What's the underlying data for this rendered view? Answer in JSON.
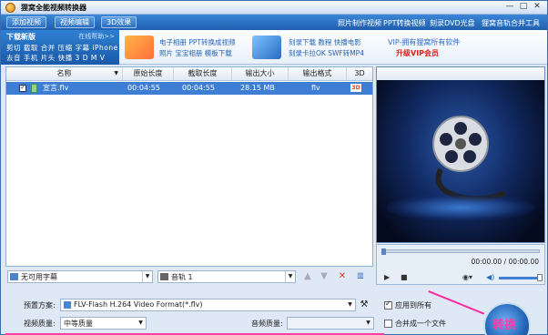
{
  "window": {
    "title": "狸窝全能视频转换器",
    "controls": [
      "—",
      "□",
      "✕"
    ]
  },
  "menubar": {
    "buttons": [
      "添加视频",
      "视频编辑",
      "3D效果"
    ],
    "links": [
      "照片制作视频",
      "PPT转换视频",
      "刻录DVD光盘",
      "狸窝音轨合并工具"
    ]
  },
  "banner": {
    "download": {
      "title": "下载新版",
      "more": "在线帮助>>",
      "row1": "剪切 截取 合并 压缩 字幕 iPhone",
      "row2": "去音 手机 片头 快播 3 D M V"
    },
    "promo1": {
      "line1": "电子相册 PPT转换成视频",
      "line2": "照片 宝宝相册 模板下载"
    },
    "promo2": {
      "line1": "刻录下载 教程 快播电影",
      "line2": "刻录卡拉OK SWF转MP4"
    },
    "vip": {
      "line1": "VIP-拥有狸窝所有软件",
      "line2": "升级VIP会员"
    }
  },
  "file_list": {
    "columns": [
      "名称",
      "原始长度",
      "截取长度",
      "输出大小",
      "输出格式",
      "3D"
    ],
    "rows": [
      {
        "name": "宣言.flv",
        "original": "00:04:55",
        "clip": "00:04:55",
        "size": "28.15 MB",
        "format": "flv",
        "checked": true
      }
    ]
  },
  "list_toolbar": {
    "subtitle": "无可用字幕",
    "audio_track": "音轨 1"
  },
  "player": {
    "time": "00:00.00 / 00:00.00",
    "volume": 1.0
  },
  "settings": {
    "preset_label": "预置方案:",
    "preset_value": "FLV-Flash H.264 Video Format(*.flv)",
    "apply_all_label": "应用到所有",
    "apply_all_checked": true,
    "video_quality_label": "视频质量:",
    "video_quality_value": "中等质量",
    "audio_quality_label": "音频质量:",
    "audio_quality_value": "",
    "merge_label": "合并成一个文件",
    "merge_checked": false
  },
  "convert_button": {
    "label": "转换"
  },
  "colors": {
    "accent": "#2f78c8",
    "highlight_row": "#3d7ed4",
    "annotation": "#ff3fa4"
  }
}
